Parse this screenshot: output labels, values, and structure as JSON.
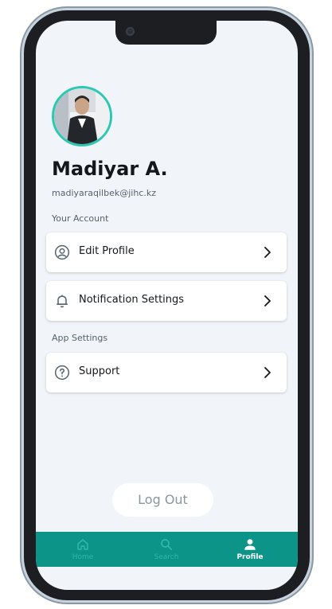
{
  "profile": {
    "name": "Madiyar A.",
    "email": "madiyaraqilbek@jihc.kz"
  },
  "sections": {
    "account": "Your Account",
    "app": "App Settings"
  },
  "menu": {
    "edit_profile": "Edit Profile",
    "notification_settings": "Notification Settings",
    "support": "Support"
  },
  "logout_label": "Log Out",
  "nav": {
    "home": "Home",
    "search": "Search",
    "profile": "Profile",
    "active": "profile"
  },
  "icons": {
    "edit_profile": "account-circle-icon",
    "notifications": "bell-icon",
    "support": "help-circle-icon",
    "chevron": "chevron-right-icon",
    "home": "home-icon",
    "search": "search-icon",
    "profile": "person-icon"
  },
  "colors": {
    "accent": "#0b9487",
    "avatar_ring": "#2bc9b2",
    "background": "#f1f4f8",
    "text_primary": "#14181b",
    "text_secondary": "#57636c"
  }
}
